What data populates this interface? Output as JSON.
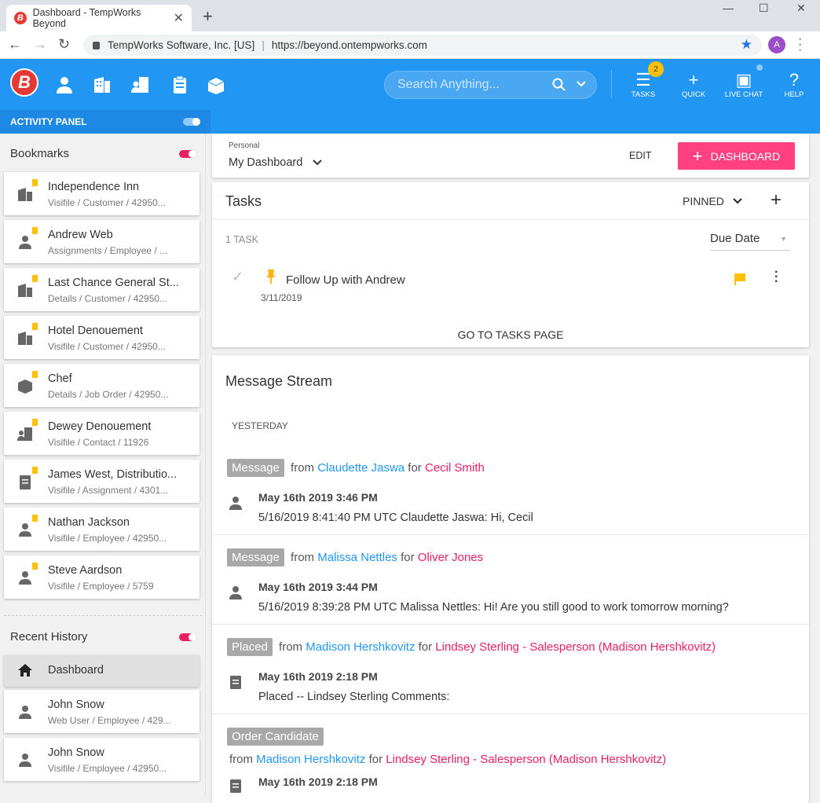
{
  "browser": {
    "tab_title": "Dashboard - TempWorks Beyond",
    "favicon": "B",
    "site_identity": "TempWorks Software, Inc. [US]",
    "url": "https://beyond.ontempworks.com",
    "profile_initial": "A"
  },
  "appbar": {
    "logo": "B",
    "search_placeholder": "Search Anything...",
    "tasks_label": "TASKS",
    "tasks_badge": "2",
    "quick_label": "QUICK",
    "livechat_label": "LIVE CHAT",
    "help_label": "HELP"
  },
  "activity_panel": {
    "label": "ACTIVITY PANEL"
  },
  "bookmarks": {
    "title": "Bookmarks",
    "items": [
      {
        "title": "Independence Inn",
        "sub": "Visifile / Customer / 42950...",
        "icon": "building-icon"
      },
      {
        "title": "Andrew Web",
        "sub": "Assignments / Employee / ...",
        "icon": "person-icon"
      },
      {
        "title": "Last Chance General St...",
        "sub": "Details / Customer / 42950...",
        "icon": "building-icon"
      },
      {
        "title": "Hotel Denouement",
        "sub": "Visifile / Customer / 42950...",
        "icon": "building-icon"
      },
      {
        "title": "Chef",
        "sub": "Details / Job Order / 42950...",
        "icon": "box-icon"
      },
      {
        "title": "Dewey Denouement",
        "sub": "Visifile / Contact / 11926",
        "icon": "contact-icon"
      },
      {
        "title": "James West, Distributio...",
        "sub": "Visifile / Assignment / 4301...",
        "icon": "clipboard-icon"
      },
      {
        "title": "Nathan Jackson",
        "sub": "Visifile / Employee / 42950...",
        "icon": "person-icon"
      },
      {
        "title": "Steve Aardson",
        "sub": "Visifile / Employee / 5759",
        "icon": "person-icon"
      }
    ]
  },
  "recent": {
    "title": "Recent History",
    "dashboard": "Dashboard",
    "items": [
      {
        "title": "John Snow",
        "sub": "Web User / Employee / 429..."
      },
      {
        "title": "John Snow",
        "sub": "Visifile / Employee / 42950..."
      }
    ]
  },
  "dashboard_header": {
    "personal_label": "Personal",
    "selected": "My Dashboard",
    "edit_label": "EDIT",
    "add_label": "DASHBOARD"
  },
  "tasks": {
    "title": "Tasks",
    "filter": "PINNED",
    "count": "1 TASK",
    "sort": "Due Date",
    "item_title": "Follow Up with Andrew",
    "item_date": "3/11/2019",
    "goto": "GO TO TASKS PAGE"
  },
  "stream": {
    "title": "Message Stream",
    "section": "YESTERDAY",
    "messages": [
      {
        "tag": "Message",
        "from_label": "from",
        "from": "Claudette Jaswa",
        "for_label": "for",
        "for": "Cecil Smith",
        "date": "May 16th 2019 3:46 PM",
        "body": "5/16/2019 8:41:40 PM UTC Claudette Jaswa: Hi, Cecil"
      },
      {
        "tag": "Message",
        "from_label": "from",
        "from": "Malissa Nettles",
        "for_label": "for",
        "for": "Oliver Jones",
        "date": "May 16th 2019 3:44 PM",
        "body": "5/16/2019 8:39:28 PM UTC Malissa Nettles: Hi! Are you still good to work tomorrow morning?"
      },
      {
        "tag": "Placed",
        "from_label": "from",
        "from": "Madison Hershkovitz",
        "for_label": "for",
        "for": "Lindsey Sterling - Salesperson (Madison Hershkovitz)",
        "date": "May 16th 2019 2:18 PM",
        "body": "Placed -- Lindsey Sterling Comments:"
      },
      {
        "tag": "Order Candidate",
        "from_label": "from",
        "from": "Madison Hershkovitz",
        "for_label": "for",
        "for": "Lindsey Sterling - Salesperson (Madison Hershkovitz)",
        "date": "May 16th 2019 2:18 PM",
        "body": ""
      }
    ]
  }
}
